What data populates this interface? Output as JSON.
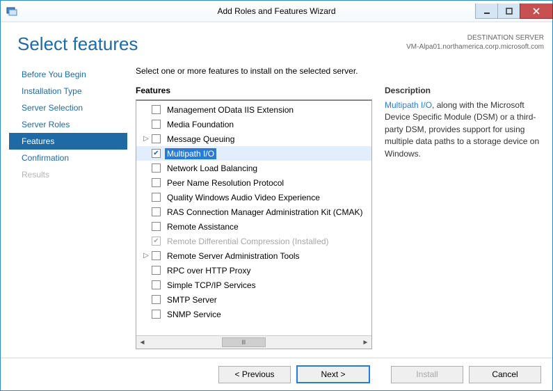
{
  "window": {
    "title": "Add Roles and Features Wizard"
  },
  "header": {
    "page_title": "Select features",
    "dest_label": "DESTINATION SERVER",
    "dest_host": "VM-Alpa01.northamerica.corp.microsoft.com"
  },
  "nav": {
    "items": [
      {
        "label": "Before You Begin",
        "active": false,
        "enabled": true
      },
      {
        "label": "Installation Type",
        "active": false,
        "enabled": true
      },
      {
        "label": "Server Selection",
        "active": false,
        "enabled": true
      },
      {
        "label": "Server Roles",
        "active": false,
        "enabled": true
      },
      {
        "label": "Features",
        "active": true,
        "enabled": true
      },
      {
        "label": "Confirmation",
        "active": false,
        "enabled": true
      },
      {
        "label": "Results",
        "active": false,
        "enabled": false
      }
    ]
  },
  "content": {
    "instruction": "Select one or more features to install on the selected server.",
    "features_heading": "Features",
    "description_heading": "Description",
    "description_highlight": "Multipath I/O",
    "description_text": ", along with the Microsoft Device Specific Module (DSM) or a third-party DSM, provides support for using multiple data paths to a storage device on Windows."
  },
  "features": [
    {
      "label": "Management OData IIS Extension",
      "checked": false,
      "expandable": false,
      "selected": false,
      "disabled": false
    },
    {
      "label": "Media Foundation",
      "checked": false,
      "expandable": false,
      "selected": false,
      "disabled": false
    },
    {
      "label": "Message Queuing",
      "checked": false,
      "expandable": true,
      "selected": false,
      "disabled": false
    },
    {
      "label": "Multipath I/O",
      "checked": true,
      "expandable": false,
      "selected": true,
      "disabled": false
    },
    {
      "label": "Network Load Balancing",
      "checked": false,
      "expandable": false,
      "selected": false,
      "disabled": false
    },
    {
      "label": "Peer Name Resolution Protocol",
      "checked": false,
      "expandable": false,
      "selected": false,
      "disabled": false
    },
    {
      "label": "Quality Windows Audio Video Experience",
      "checked": false,
      "expandable": false,
      "selected": false,
      "disabled": false
    },
    {
      "label": "RAS Connection Manager Administration Kit (CMAK)",
      "checked": false,
      "expandable": false,
      "selected": false,
      "disabled": false
    },
    {
      "label": "Remote Assistance",
      "checked": false,
      "expandable": false,
      "selected": false,
      "disabled": false
    },
    {
      "label": "Remote Differential Compression (Installed)",
      "checked": true,
      "expandable": false,
      "selected": false,
      "disabled": true
    },
    {
      "label": "Remote Server Administration Tools",
      "checked": false,
      "expandable": true,
      "selected": false,
      "disabled": false
    },
    {
      "label": "RPC over HTTP Proxy",
      "checked": false,
      "expandable": false,
      "selected": false,
      "disabled": false
    },
    {
      "label": "Simple TCP/IP Services",
      "checked": false,
      "expandable": false,
      "selected": false,
      "disabled": false
    },
    {
      "label": "SMTP Server",
      "checked": false,
      "expandable": false,
      "selected": false,
      "disabled": false
    },
    {
      "label": "SNMP Service",
      "checked": false,
      "expandable": false,
      "selected": false,
      "disabled": false
    }
  ],
  "footer": {
    "previous": "< Previous",
    "next": "Next >",
    "install": "Install",
    "cancel": "Cancel"
  }
}
